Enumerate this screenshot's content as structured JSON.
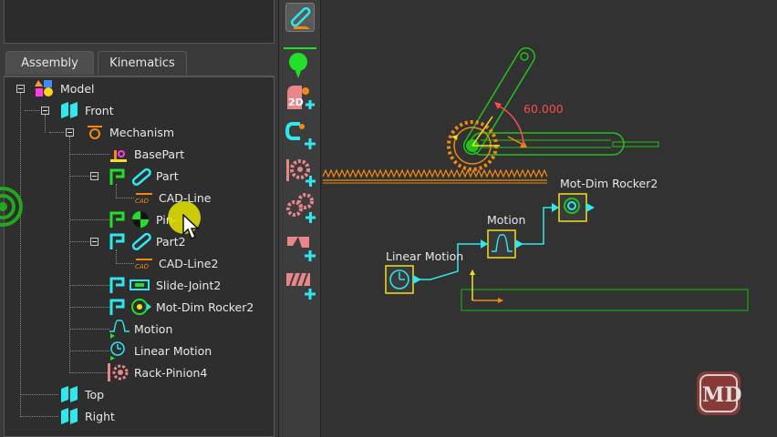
{
  "tabs": [
    {
      "label": "Assembly",
      "active": true
    },
    {
      "label": "Kinematics",
      "active": false
    }
  ],
  "tree": {
    "model": "Model",
    "front": "Front",
    "mechanism": "Mechanism",
    "base_part": "BasePart",
    "part": "Part",
    "cad_line": "CAD-Line",
    "pin_joint": "Pin-",
    "part2": "Part2",
    "cad_line2": "CAD-Line2",
    "slide_joint2": "Slide-Joint2",
    "mot_dim_rocker2": "Mot-Dim Rocker2",
    "motion": "Motion",
    "linear_motion": "Linear Motion",
    "rack_pinion4": "Rack-Pinion4",
    "top": "Top",
    "right": "Right"
  },
  "toolbar": {
    "icons": [
      "link-icon",
      "point-icon",
      "2d-part-icon",
      "magnet-add-icon",
      "gear-add-icon",
      "gears-add-icon",
      "shape-add-icon",
      "rack-add-icon"
    ]
  },
  "canvas": {
    "angle_label": "60.000",
    "blocks": {
      "linear_motion": "Linear Motion",
      "motion": "Motion",
      "mot_dim_rocker2": "Mot-Dim Rocker2"
    }
  },
  "colors": {
    "accent_cyan": "#2ee8f0",
    "accent_green": "#22c21c",
    "gear_orange": "#f08a14",
    "angle_red": "#ff4b4b",
    "highlight_yellow": "#e6e600"
  },
  "watermark_text": "MD"
}
